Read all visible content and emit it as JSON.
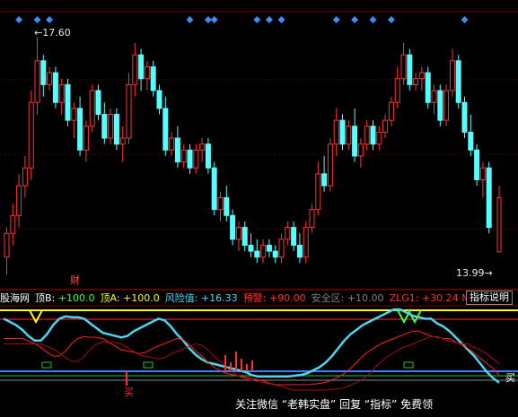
{
  "chart_data": {
    "type": "candlestick",
    "price_max_label": "17.60",
    "price_min_label": "13.99",
    "finance_marker": "财",
    "candles": [
      [
        13.9,
        14.4,
        13.6,
        14.3
      ],
      [
        14.3,
        14.8,
        14.1,
        14.6
      ],
      [
        14.6,
        15.3,
        14.4,
        15.1
      ],
      [
        15.1,
        15.6,
        14.9,
        15.4
      ],
      [
        15.4,
        16.7,
        15.2,
        16.5
      ],
      [
        16.5,
        17.6,
        16.3,
        17.2
      ],
      [
        17.2,
        17.3,
        16.6,
        16.8
      ],
      [
        16.8,
        17.1,
        16.7,
        17.0
      ],
      [
        17.0,
        17.1,
        16.4,
        16.5
      ],
      [
        16.5,
        16.9,
        16.3,
        16.8
      ],
      [
        16.8,
        16.9,
        16.1,
        16.2
      ],
      [
        16.2,
        16.5,
        15.9,
        16.4
      ],
      [
        16.4,
        16.6,
        15.6,
        15.7
      ],
      [
        15.7,
        16.2,
        15.5,
        16.1
      ],
      [
        16.1,
        16.8,
        16.0,
        16.7
      ],
      [
        16.7,
        16.8,
        16.2,
        16.3
      ],
      [
        16.3,
        16.5,
        15.8,
        15.9
      ],
      [
        15.9,
        16.4,
        15.8,
        16.3
      ],
      [
        16.3,
        16.4,
        15.7,
        15.8
      ],
      [
        15.8,
        16.1,
        15.5,
        15.9
      ],
      [
        15.9,
        17.0,
        15.8,
        16.8
      ],
      [
        16.8,
        17.5,
        16.6,
        17.3
      ],
      [
        17.3,
        17.4,
        16.7,
        16.9
      ],
      [
        16.9,
        17.2,
        16.7,
        17.1
      ],
      [
        17.1,
        17.2,
        16.6,
        16.7
      ],
      [
        16.7,
        16.8,
        16.3,
        16.4
      ],
      [
        16.4,
        16.6,
        15.6,
        15.7
      ],
      [
        15.7,
        16.0,
        15.6,
        15.9
      ],
      [
        15.9,
        16.1,
        15.4,
        15.5
      ],
      [
        15.5,
        15.8,
        15.4,
        15.7
      ],
      [
        15.7,
        15.8,
        15.3,
        15.4
      ],
      [
        15.4,
        15.8,
        15.3,
        15.7
      ],
      [
        15.7,
        15.9,
        15.5,
        15.8
      ],
      [
        15.8,
        15.9,
        15.3,
        15.4
      ],
      [
        15.4,
        15.5,
        14.6,
        14.7
      ],
      [
        14.7,
        15.0,
        14.5,
        14.9
      ],
      [
        14.9,
        15.1,
        14.5,
        14.6
      ],
      [
        14.6,
        14.7,
        14.1,
        14.2
      ],
      [
        14.2,
        14.5,
        14.0,
        14.4
      ],
      [
        14.4,
        14.5,
        14.0,
        14.1
      ],
      [
        14.1,
        14.3,
        13.9,
        14.0
      ],
      [
        14.0,
        14.2,
        13.8,
        13.9
      ],
      [
        13.9,
        14.2,
        13.8,
        14.1
      ],
      [
        14.1,
        14.2,
        13.9,
        14.0
      ],
      [
        14.0,
        14.1,
        13.8,
        13.9
      ],
      [
        13.9,
        14.3,
        13.8,
        14.2
      ],
      [
        14.2,
        14.5,
        14.1,
        14.4
      ],
      [
        14.4,
        14.5,
        14.0,
        14.1
      ],
      [
        14.1,
        14.3,
        13.8,
        13.9
      ],
      [
        13.9,
        14.5,
        13.8,
        14.4
      ],
      [
        14.4,
        14.8,
        14.3,
        14.7
      ],
      [
        14.7,
        15.5,
        14.6,
        15.3
      ],
      [
        15.3,
        15.6,
        15.0,
        15.1
      ],
      [
        15.1,
        15.9,
        15.0,
        15.8
      ],
      [
        15.8,
        16.4,
        15.6,
        16.2
      ],
      [
        16.2,
        16.3,
        15.7,
        15.8
      ],
      [
        15.8,
        16.2,
        15.7,
        16.1
      ],
      [
        16.1,
        16.4,
        15.5,
        15.6
      ],
      [
        15.6,
        15.9,
        15.4,
        15.8
      ],
      [
        15.8,
        16.2,
        15.7,
        16.1
      ],
      [
        16.1,
        16.2,
        15.7,
        15.8
      ],
      [
        15.8,
        16.1,
        15.7,
        16.0
      ],
      [
        16.0,
        16.3,
        15.9,
        16.2
      ],
      [
        16.2,
        16.6,
        16.1,
        16.5
      ],
      [
        16.5,
        17.1,
        16.4,
        16.9
      ],
      [
        16.9,
        17.5,
        16.8,
        17.3
      ],
      [
        17.3,
        17.4,
        16.7,
        16.8
      ],
      [
        16.8,
        17.0,
        16.7,
        16.9
      ],
      [
        16.9,
        17.1,
        16.7,
        17.0
      ],
      [
        17.0,
        17.1,
        16.4,
        16.5
      ],
      [
        16.5,
        16.8,
        16.3,
        16.7
      ],
      [
        16.7,
        16.8,
        16.1,
        16.2
      ],
      [
        16.2,
        16.8,
        16.1,
        16.7
      ],
      [
        16.7,
        17.4,
        16.6,
        17.2
      ],
      [
        17.2,
        17.3,
        16.4,
        16.5
      ],
      [
        16.5,
        16.6,
        15.9,
        16.0
      ],
      [
        16.0,
        16.3,
        15.6,
        15.7
      ],
      [
        15.7,
        15.8,
        15.1,
        15.2
      ],
      [
        15.2,
        15.5,
        14.9,
        15.4
      ],
      [
        15.4,
        15.5,
        14.3,
        14.4
      ]
    ],
    "last_bar": {
      "o": 13.99,
      "h": 15.1,
      "l": 13.99,
      "c": 14.9
    },
    "top_markers_idx": [
      2,
      5,
      7,
      30,
      33,
      34,
      41,
      43,
      45,
      54,
      57,
      60,
      63,
      75
    ],
    "indicator": {
      "series_names": [
        "股海网",
        "顶B",
        "顶A",
        "风险值",
        "预警",
        "安全区",
        "ZLG1",
        "M"
      ],
      "values": [
        "+100.0",
        "+100.0",
        "+16.33",
        "+90.00",
        "+10.00",
        "+30.24"
      ],
      "header": {
        "brand": "股海网",
        "topB_label": "顶B:",
        "topB_value": "+100.0",
        "topA_label": "顶A:",
        "topA_value": "+100.0",
        "risk_label": "风险值:",
        "risk_value": "+16.33",
        "warn_label": "预警:",
        "warn_value": "+90.00",
        "safe_label": "安全区:",
        "safe_value": "+10.00",
        "zlg_label": "ZLG1:",
        "zlg_value": "+30.24",
        "m_label": "M"
      },
      "buy_label": "买",
      "help_button": "指标说明",
      "risk_series": [
        88,
        84,
        80,
        74,
        66,
        60,
        60,
        68,
        80,
        88,
        91,
        90,
        90,
        88,
        82,
        76,
        70,
        68,
        66,
        64,
        66,
        72,
        76,
        80,
        84,
        88,
        86,
        78,
        68,
        60,
        50,
        42,
        36,
        32,
        30,
        28,
        26,
        24,
        22,
        20,
        16,
        14,
        14,
        14,
        14,
        14,
        14,
        15,
        16,
        18,
        22,
        26,
        32,
        40,
        50,
        60,
        68,
        74,
        80,
        84,
        88,
        92,
        96,
        100,
        100,
        96,
        92,
        90,
        88,
        88,
        82,
        78,
        72,
        64,
        56,
        48,
        40,
        30,
        20,
        12,
        6
      ]
    }
  },
  "colors": {
    "up": "#ff3232",
    "down": "#54ffff",
    "marker": "#3b8ef5",
    "risk_line": "#4fd6ee",
    "warn_line": "#ffff00",
    "safe_line": "#ff3030",
    "ma_red": "#ff2020"
  },
  "watermark": "关注微信 “老韩实盘” 回复 “指标” 免费领"
}
